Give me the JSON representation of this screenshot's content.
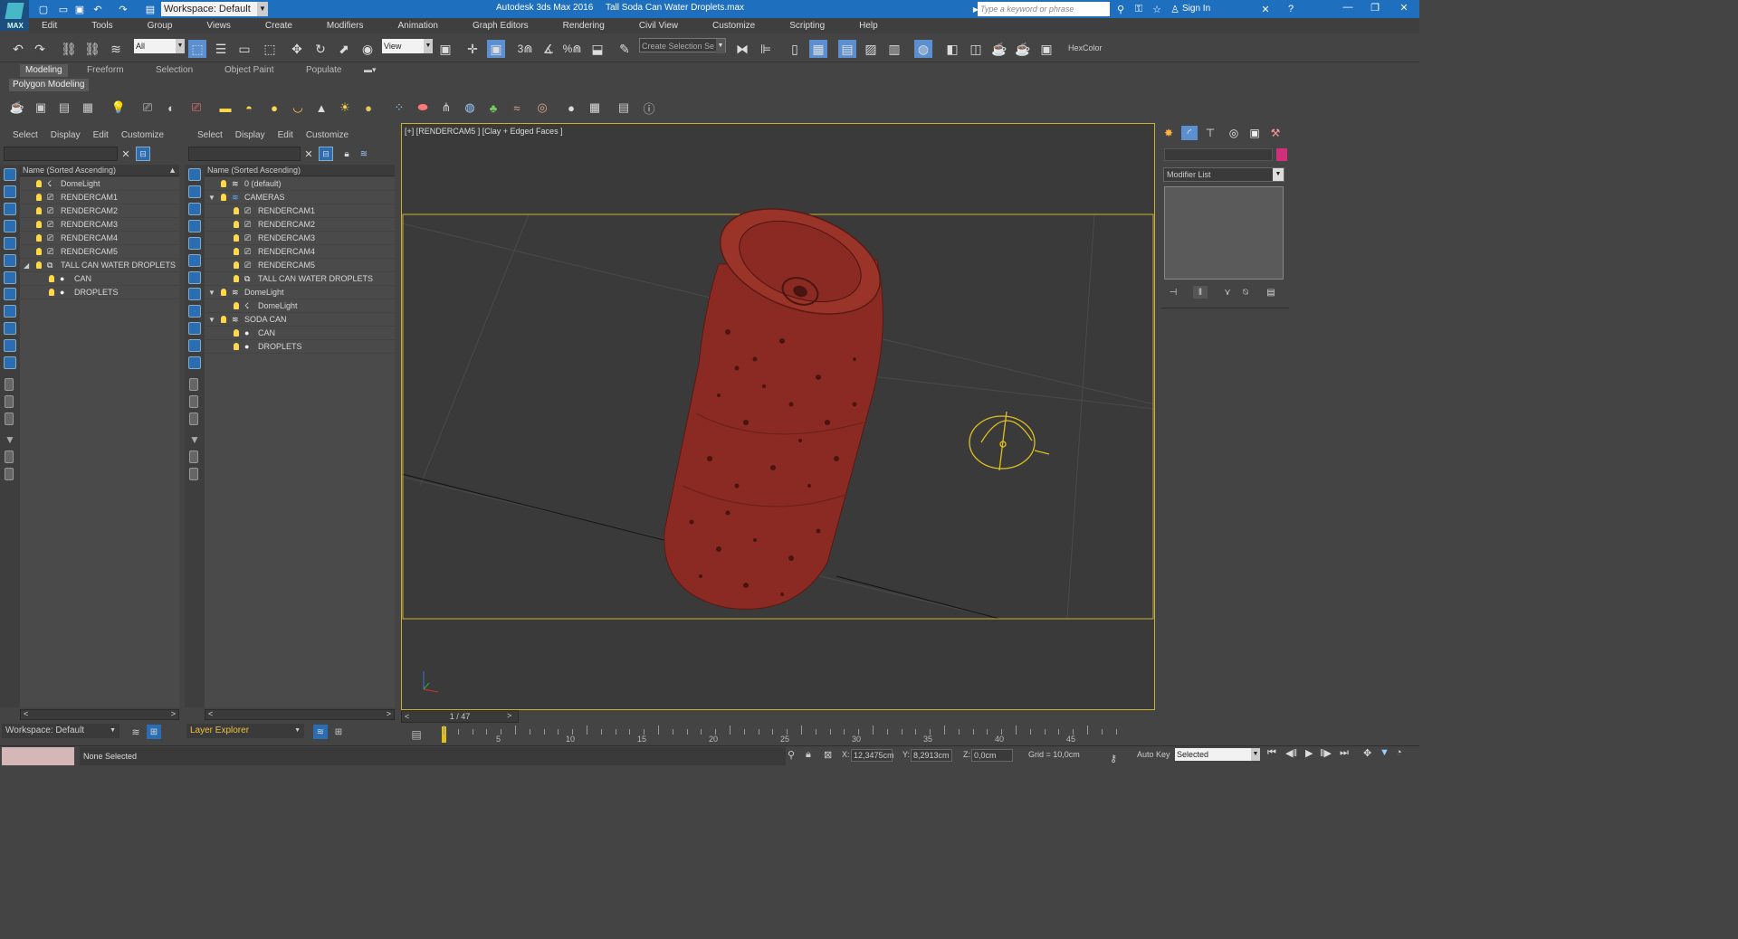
{
  "titlebar": {
    "workspace": "Workspace: Default",
    "app_title": "Autodesk 3ds Max 2016",
    "file_title": "Tall Soda Can Water Droplets.max",
    "search_placeholder": "Type a keyword or phrase",
    "sign_in": "Sign In",
    "logo_text": "MAX"
  },
  "menu": [
    "Edit",
    "Tools",
    "Group",
    "Views",
    "Create",
    "Modifiers",
    "Animation",
    "Graph Editors",
    "Rendering",
    "Civil View",
    "Customize",
    "Scripting",
    "Help"
  ],
  "toolbar": {
    "selection_filter": "All",
    "ref_coord": "View",
    "named_selection": "Create Selection Se",
    "hexcolor": "HexColor",
    "snap_3": "3",
    "snap_percent": "%"
  },
  "ribbon": {
    "tabs": [
      "Modeling",
      "Freeform",
      "Selection",
      "Object Paint",
      "Populate"
    ],
    "active_panel": "Polygon Modeling"
  },
  "scene_explorer": {
    "menu": [
      "Select",
      "Display",
      "Edit",
      "Customize"
    ],
    "column": "Name (Sorted Ascending)",
    "items": [
      "DomeLight",
      "RENDERCAM1",
      "RENDERCAM2",
      "RENDERCAM3",
      "RENDERCAM4",
      "RENDERCAM5",
      "TALL CAN WATER DROPLETS",
      "CAN",
      "DROPLETS"
    ],
    "footer": "Workspace: Default"
  },
  "layer_explorer": {
    "menu": [
      "Select",
      "Display",
      "Edit",
      "Customize"
    ],
    "column": "Name (Sorted Ascending)",
    "items": [
      "0 (default)",
      "CAMERAS",
      "RENDERCAM1",
      "RENDERCAM2",
      "RENDERCAM3",
      "RENDERCAM4",
      "RENDERCAM5",
      "TALL CAN WATER DROPLETS",
      "DomeLight",
      "DomeLight",
      "SODA CAN",
      "CAN",
      "DROPLETS"
    ],
    "footer": "Layer Explorer"
  },
  "viewport": {
    "label": "[+] [RENDERCAM5 ] [Clay + Edged Faces ]"
  },
  "command_panel": {
    "modifier_list": "Modifier List"
  },
  "timeline": {
    "frame": "1 / 47",
    "prev": "<",
    "next": ">",
    "ticks": [
      "5",
      "10",
      "15",
      "20",
      "25",
      "30",
      "35",
      "40",
      "45"
    ]
  },
  "status": {
    "selection": "None Selected",
    "x_label": "X:",
    "x": "12,3475cm",
    "y_label": "Y:",
    "y": "8,2913cm",
    "z_label": "Z:",
    "z": "0,0cm",
    "grid": "Grid = 10,0cm",
    "autokey": "Auto Key",
    "key_mode": "Selected"
  },
  "colors": {
    "title_blue": "#1f6fbf",
    "viewport_border": "#c9b233",
    "can_red": "#8a2a22",
    "object_color": "#d0307a"
  }
}
